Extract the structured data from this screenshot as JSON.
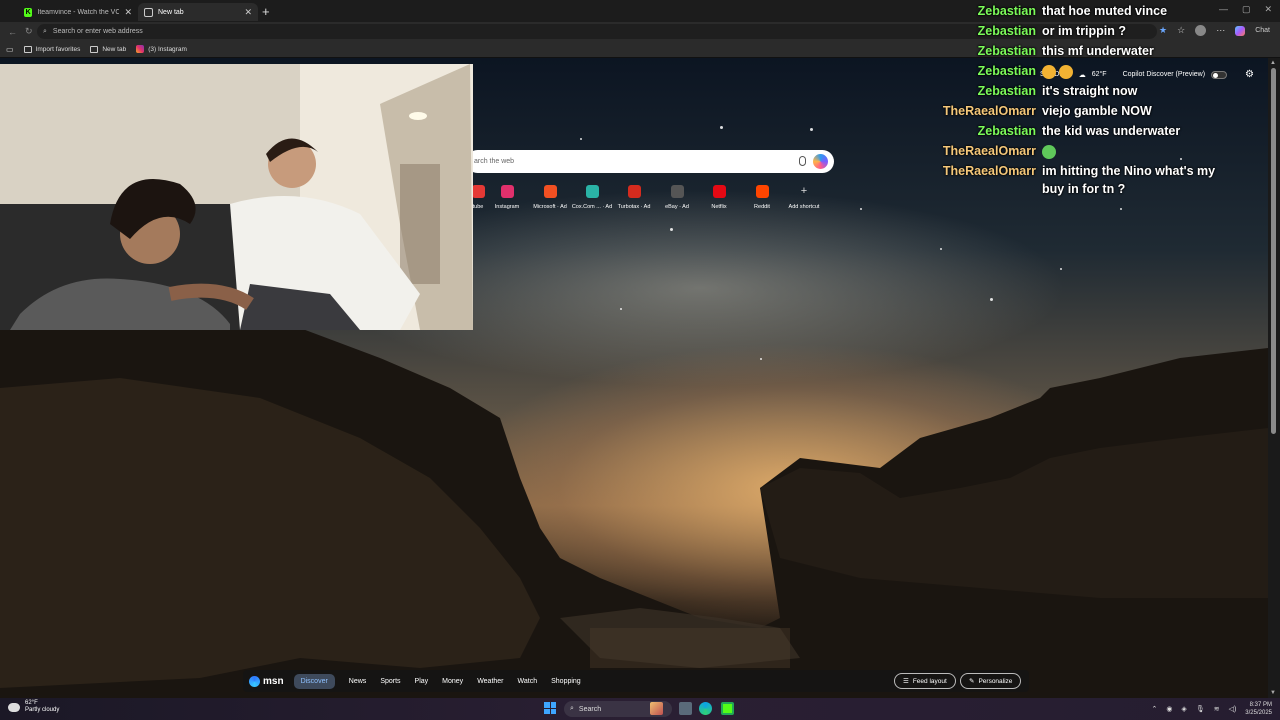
{
  "browser": {
    "tabs": [
      {
        "title": "Iteamvince - Watch the VOD on Ki",
        "favicon": "kick-icon",
        "active": false
      },
      {
        "title": "New tab",
        "favicon": "newtab-icon",
        "active": true
      }
    ],
    "address_placeholder": "Search or enter web address",
    "favorites": [
      "Import favorites",
      "New tab",
      "(3) Instagram"
    ],
    "copilot_label": "Chat"
  },
  "newtab": {
    "search_placeholder": "arch the web",
    "shortcuts": [
      {
        "label": "tube",
        "icon": "youtube-icon",
        "color": "#e53935"
      },
      {
        "label": "Instagram",
        "icon": "instagram-icon",
        "color": "#e1306c"
      },
      {
        "label": "Microsoft · Ad",
        "icon": "microsoft-icon",
        "color": "#f25022"
      },
      {
        "label": "Cox.Com ... · Ad",
        "icon": "cox-icon",
        "color": "#2ab3a6"
      },
      {
        "label": "Turbotax · Ad",
        "icon": "turbotax-icon",
        "color": "#d52b1e"
      },
      {
        "label": "eBay · Ad",
        "icon": "ebay-icon",
        "color": "#555555"
      },
      {
        "label": "Netflix",
        "icon": "netflix-icon",
        "color": "#e50914"
      },
      {
        "label": "Reddit",
        "icon": "reddit-icon",
        "color": "#ff4500"
      },
      {
        "label": "Add shortcut",
        "icon": "plus-icon",
        "color": "transparent"
      }
    ],
    "location": "San Diego",
    "temp": "62°F",
    "copilot_discover": "Copilot Discover (Preview)"
  },
  "chat": [
    {
      "user": "Zebastian",
      "color": "#7cfc5a",
      "text": "that hoe muted vince"
    },
    {
      "user": "Zebastian",
      "color": "#7cfc5a",
      "text": "or im trippin ?"
    },
    {
      "user": "Zebastian",
      "color": "#7cfc5a",
      "text": "this mf underwater"
    },
    {
      "user": "Zebastian",
      "color": "#7cfc5a",
      "text": ""
    },
    {
      "user": "Zebastian",
      "color": "#7cfc5a",
      "text": "it's straight now"
    },
    {
      "user": "TheRaealOmarr",
      "color": "#f5c87a",
      "text": "viejo gamble NOW"
    },
    {
      "user": "Zebastian",
      "color": "#7cfc5a",
      "text": "the kid was underwater"
    },
    {
      "user": "TheRaealOmarr",
      "color": "#f5c87a",
      "text": ""
    },
    {
      "user": "TheRaealOmarr",
      "color": "#f5c87a",
      "text": "im hitting the Nino what's my buy in for tn ?"
    }
  ],
  "msn": {
    "logo": "msn",
    "tabs": [
      "Discover",
      "News",
      "Sports",
      "Play",
      "Money",
      "Weather",
      "Watch",
      "Shopping"
    ],
    "feed_layout": "Feed layout",
    "personalize": "Personalize"
  },
  "taskbar": {
    "temp": "62°F",
    "condition": "Partly cloudy",
    "search": "Search",
    "time": "8:37 PM",
    "date": "3/25/2025"
  }
}
